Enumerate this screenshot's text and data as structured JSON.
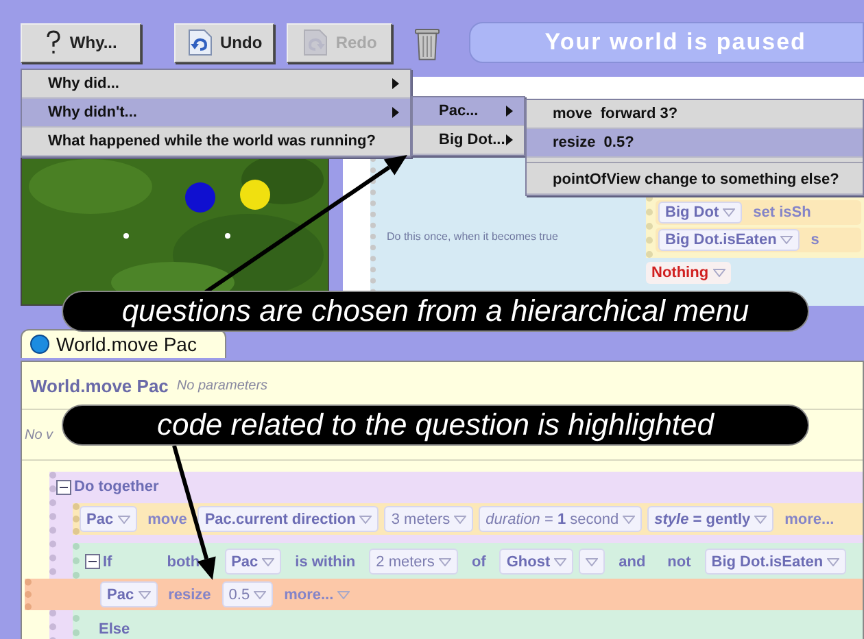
{
  "toolbar": {
    "buttons": [
      {
        "label": "Why...",
        "disabled": false
      },
      {
        "label": "Undo",
        "disabled": false
      },
      {
        "label": "Redo",
        "disabled": true
      }
    ],
    "status": "Your world is paused"
  },
  "event": {
    "caption": "Do this once, when it becomes true",
    "rows": [
      [
        {
          "text": "Big Dot",
          "kind": "object",
          "dropdown": true
        },
        {
          "text": "set  isSh",
          "kind": "method",
          "dropdown": false
        }
      ],
      [
        {
          "text": "Big Dot.isEaten",
          "kind": "object",
          "dropdown": true
        },
        {
          "text": "s",
          "kind": "method",
          "dropdown": false
        }
      ]
    ],
    "fallback": {
      "text": "Nothing",
      "kind": "warning",
      "dropdown": true
    }
  },
  "editor": {
    "tab": "World.move Pac",
    "title": "World.move Pac",
    "parameters": "No parameters",
    "variables": "No v",
    "code": {
      "label": "Do together",
      "expanded": true,
      "statements": [
        {
          "kind": "call",
          "highlighted": false,
          "chips": [
            {
              "text": "Pac",
              "kind": "object",
              "dropdown": true
            },
            {
              "text": "move",
              "kind": "method",
              "dropdown": false
            },
            {
              "text": "Pac.current direction",
              "kind": "object",
              "dropdown": true
            },
            {
              "text": "3 meters",
              "kind": "value",
              "dropdown": true
            },
            {
              "text": "*duration* = **1** second",
              "kind": "value",
              "dropdown": true
            },
            {
              "text": "*style* = gently",
              "kind": "object",
              "dropdown": true
            },
            {
              "text": "more...",
              "kind": "method",
              "dropdown": false
            }
          ]
        },
        {
          "kind": "if",
          "label": "If",
          "expanded": true,
          "condition": [
            {
              "text": "both",
              "kind": "keyword",
              "dropdown": false
            },
            {
              "text": "Pac",
              "kind": "object",
              "dropdown": true
            },
            {
              "text": "is within",
              "kind": "keyword",
              "dropdown": false
            },
            {
              "text": "2 meters",
              "kind": "value",
              "dropdown": true
            },
            {
              "text": "of",
              "kind": "keyword",
              "dropdown": false
            },
            {
              "text": "Ghost",
              "kind": "object",
              "dropdown": true
            },
            {
              "kind": "caret",
              "dropdown": true
            },
            {
              "text": "and",
              "kind": "keyword",
              "dropdown": false
            },
            {
              "text": "not",
              "kind": "keyword",
              "dropdown": false
            },
            {
              "text": "Big Dot.isEaten",
              "kind": "object",
              "dropdown": true
            }
          ],
          "then": [
            {
              "kind": "call",
              "highlighted": true,
              "chips": [
                {
                  "text": "Pac",
                  "kind": "object",
                  "dropdown": true
                },
                {
                  "text": "resize",
                  "kind": "method",
                  "dropdown": false
                },
                {
                  "text": "0.5",
                  "kind": "value",
                  "dropdown": true
                },
                {
                  "text": "more...",
                  "kind": "method",
                  "dropdown": true
                }
              ]
            }
          ],
          "else_label": "Else"
        }
      ]
    }
  },
  "menus": [
    {
      "items": [
        {
          "kind": "item",
          "label": "Why did...",
          "submenu": true,
          "selected": false
        },
        {
          "kind": "item",
          "label": "Why didn't...",
          "submenu": true,
          "selected": true
        },
        {
          "kind": "item",
          "label": "What happened while the world was running?",
          "submenu": false,
          "selected": false
        }
      ]
    },
    {
      "items": [
        {
          "kind": "item",
          "label": "Pac...",
          "submenu": true,
          "selected": true
        },
        {
          "kind": "item",
          "label": "Big Dot...",
          "submenu": true,
          "selected": false
        }
      ]
    },
    {
      "items": [
        {
          "kind": "item",
          "label": "move  forward 3?",
          "submenu": false,
          "selected": false
        },
        {
          "kind": "item",
          "label": "resize  0.5?",
          "submenu": false,
          "selected": true
        },
        {
          "kind": "separator"
        },
        {
          "kind": "item",
          "label": "pointOfView change to something else?",
          "submenu": false,
          "selected": false
        }
      ]
    }
  ],
  "annotations": [
    {
      "text": "questions are chosen from a hierarchical menu"
    },
    {
      "text": "code related to the question is highlighted"
    }
  ]
}
